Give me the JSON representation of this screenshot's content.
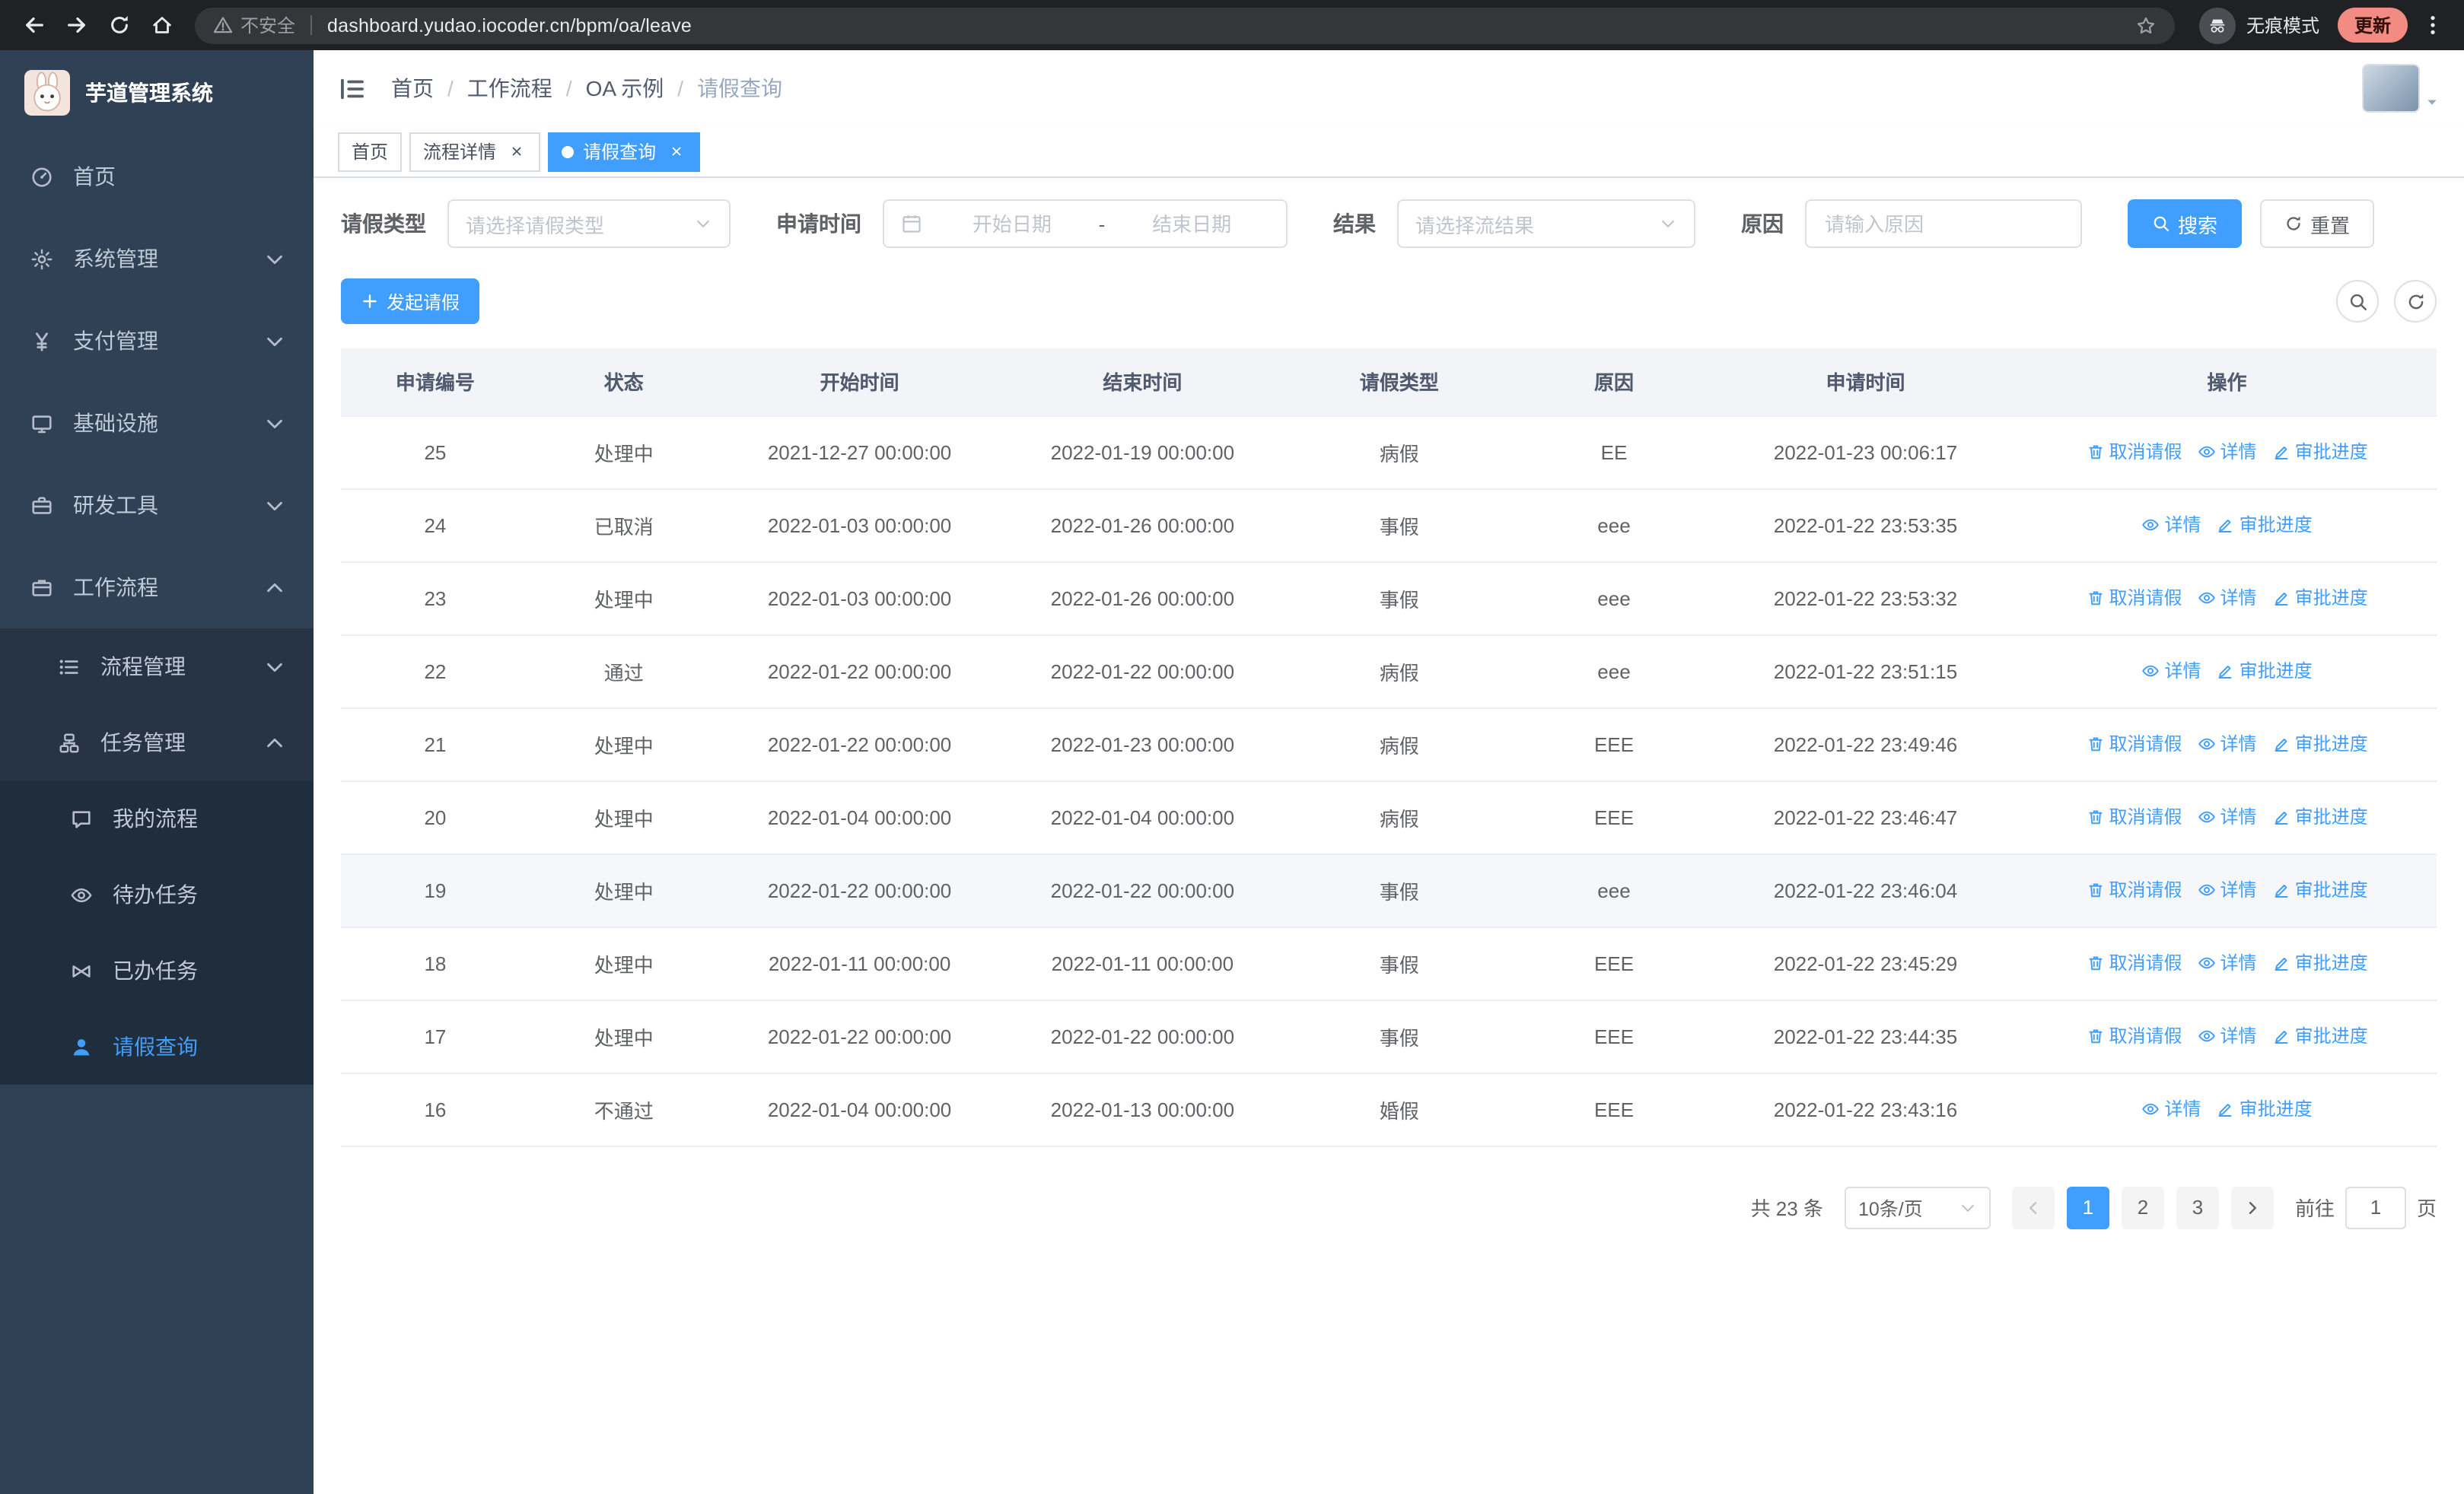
{
  "browser": {
    "security_label": "不安全",
    "url": "dashboard.yudao.iocoder.cn/bpm/oa/leave",
    "incognito_label": "无痕模式",
    "update_label": "更新",
    "nav_icons": [
      "back-icon",
      "forward-icon",
      "reload-icon",
      "home-icon"
    ]
  },
  "sidebar": {
    "logo_title": "芋道管理系统",
    "items": [
      {
        "label": "首页",
        "icon": "dashboard-icon",
        "level": 0
      },
      {
        "label": "系统管理",
        "icon": "gear-icon",
        "level": 0,
        "expandable": true
      },
      {
        "label": "支付管理",
        "icon": "yen-icon",
        "level": 0,
        "expandable": true
      },
      {
        "label": "基础设施",
        "icon": "monitor-icon",
        "level": 0,
        "expandable": true
      },
      {
        "label": "研发工具",
        "icon": "toolbox-icon",
        "level": 0,
        "expandable": true
      },
      {
        "label": "工作流程",
        "icon": "workflow-icon",
        "level": 0,
        "expandable": true,
        "expanded": true
      },
      {
        "label": "流程管理",
        "icon": "list-icon",
        "level": 1,
        "expandable": true
      },
      {
        "label": "任务管理",
        "icon": "task-icon",
        "level": 1,
        "expandable": true,
        "expanded": true
      },
      {
        "label": "我的流程",
        "icon": "chat-icon",
        "level": 2
      },
      {
        "label": "待办任务",
        "icon": "eye-icon",
        "level": 2
      },
      {
        "label": "已办任务",
        "icon": "done-icon",
        "level": 2
      },
      {
        "label": "请假查询",
        "icon": "user-icon",
        "level": 2,
        "active": true
      }
    ]
  },
  "header": {
    "breadcrumb": [
      "首页",
      "工作流程",
      "OA 示例",
      "请假查询"
    ],
    "breadcrumb_separator": "/",
    "icons": [
      "search-icon",
      "github-icon",
      "question-icon",
      "fullscreen-icon",
      "fontsize-icon"
    ]
  },
  "tabs": [
    {
      "label": "首页",
      "closable": false,
      "active": false
    },
    {
      "label": "流程详情",
      "closable": true,
      "active": false
    },
    {
      "label": "请假查询",
      "closable": true,
      "active": true
    }
  ],
  "filters": {
    "leave_type_label": "请假类型",
    "leave_type_placeholder": "请选择请假类型",
    "apply_time_label": "申请时间",
    "start_date_placeholder": "开始日期",
    "range_separator": "-",
    "end_date_placeholder": "结束日期",
    "result_label": "结果",
    "result_placeholder": "请选择流结果",
    "reason_label": "原因",
    "reason_placeholder": "请输入原因",
    "search_label": "搜索",
    "reset_label": "重置"
  },
  "toolbar": {
    "create_label": "发起请假"
  },
  "table": {
    "columns": [
      "申请编号",
      "状态",
      "开始时间",
      "结束时间",
      "请假类型",
      "原因",
      "申请时间",
      "操作"
    ],
    "rows": [
      {
        "id": "25",
        "status": "处理中",
        "start": "2021-12-27 00:00:00",
        "end": "2022-01-19 00:00:00",
        "type": "病假",
        "reason": "EE",
        "applied": "2022-01-23 00:06:17",
        "actions": [
          {
            "icon": "trash-icon",
            "label": "取消请假"
          },
          {
            "icon": "eye-icon",
            "label": "详情"
          },
          {
            "icon": "edit-icon",
            "label": "审批进度"
          }
        ]
      },
      {
        "id": "24",
        "status": "已取消",
        "start": "2022-01-03 00:00:00",
        "end": "2022-01-26 00:00:00",
        "type": "事假",
        "reason": "eee",
        "applied": "2022-01-22 23:53:35",
        "actions": [
          {
            "icon": "eye-icon",
            "label": "详情"
          },
          {
            "icon": "edit-icon",
            "label": "审批进度"
          }
        ]
      },
      {
        "id": "23",
        "status": "处理中",
        "start": "2022-01-03 00:00:00",
        "end": "2022-01-26 00:00:00",
        "type": "事假",
        "reason": "eee",
        "applied": "2022-01-22 23:53:32",
        "actions": [
          {
            "icon": "trash-icon",
            "label": "取消请假"
          },
          {
            "icon": "eye-icon",
            "label": "详情"
          },
          {
            "icon": "edit-icon",
            "label": "审批进度"
          }
        ]
      },
      {
        "id": "22",
        "status": "通过",
        "start": "2022-01-22 00:00:00",
        "end": "2022-01-22 00:00:00",
        "type": "病假",
        "reason": "eee",
        "applied": "2022-01-22 23:51:15",
        "actions": [
          {
            "icon": "eye-icon",
            "label": "详情"
          },
          {
            "icon": "edit-icon",
            "label": "审批进度"
          }
        ]
      },
      {
        "id": "21",
        "status": "处理中",
        "start": "2022-01-22 00:00:00",
        "end": "2022-01-23 00:00:00",
        "type": "病假",
        "reason": "EEE",
        "applied": "2022-01-22 23:49:46",
        "actions": [
          {
            "icon": "trash-icon",
            "label": "取消请假"
          },
          {
            "icon": "eye-icon",
            "label": "详情"
          },
          {
            "icon": "edit-icon",
            "label": "审批进度"
          }
        ]
      },
      {
        "id": "20",
        "status": "处理中",
        "start": "2022-01-04 00:00:00",
        "end": "2022-01-04 00:00:00",
        "type": "病假",
        "reason": "EEE",
        "applied": "2022-01-22 23:46:47",
        "actions": [
          {
            "icon": "trash-icon",
            "label": "取消请假"
          },
          {
            "icon": "eye-icon",
            "label": "详情"
          },
          {
            "icon": "edit-icon",
            "label": "审批进度"
          }
        ]
      },
      {
        "id": "19",
        "status": "处理中",
        "start": "2022-01-22 00:00:00",
        "end": "2022-01-22 00:00:00",
        "type": "事假",
        "reason": "eee",
        "applied": "2022-01-22 23:46:04",
        "highlighted": true,
        "actions": [
          {
            "icon": "trash-icon",
            "label": "取消请假"
          },
          {
            "icon": "eye-icon",
            "label": "详情"
          },
          {
            "icon": "edit-icon",
            "label": "审批进度"
          }
        ]
      },
      {
        "id": "18",
        "status": "处理中",
        "start": "2022-01-11 00:00:00",
        "end": "2022-01-11 00:00:00",
        "type": "事假",
        "reason": "EEE",
        "applied": "2022-01-22 23:45:29",
        "actions": [
          {
            "icon": "trash-icon",
            "label": "取消请假"
          },
          {
            "icon": "eye-icon",
            "label": "详情"
          },
          {
            "icon": "edit-icon",
            "label": "审批进度"
          }
        ]
      },
      {
        "id": "17",
        "status": "处理中",
        "start": "2022-01-22 00:00:00",
        "end": "2022-01-22 00:00:00",
        "type": "事假",
        "reason": "EEE",
        "applied": "2022-01-22 23:44:35",
        "actions": [
          {
            "icon": "trash-icon",
            "label": "取消请假"
          },
          {
            "icon": "eye-icon",
            "label": "详情"
          },
          {
            "icon": "edit-icon",
            "label": "审批进度"
          }
        ]
      },
      {
        "id": "16",
        "status": "不通过",
        "start": "2022-01-04 00:00:00",
        "end": "2022-01-13 00:00:00",
        "type": "婚假",
        "reason": "EEE",
        "applied": "2022-01-22 23:43:16",
        "actions": [
          {
            "icon": "eye-icon",
            "label": "详情"
          },
          {
            "icon": "edit-icon",
            "label": "审批进度"
          }
        ]
      }
    ]
  },
  "pagination": {
    "total_label": "共 23 条",
    "page_size_label": "10条/页",
    "pages": [
      "1",
      "2",
      "3"
    ],
    "active_page": "1",
    "goto_label": "前往",
    "goto_value": "1",
    "page_unit_label": "页"
  },
  "colors": {
    "accent": "#409eff",
    "sidebar_bg": "#304156",
    "sidebar_submenu_bg": "#1f2d3d",
    "update_chip": "#f28b82"
  }
}
